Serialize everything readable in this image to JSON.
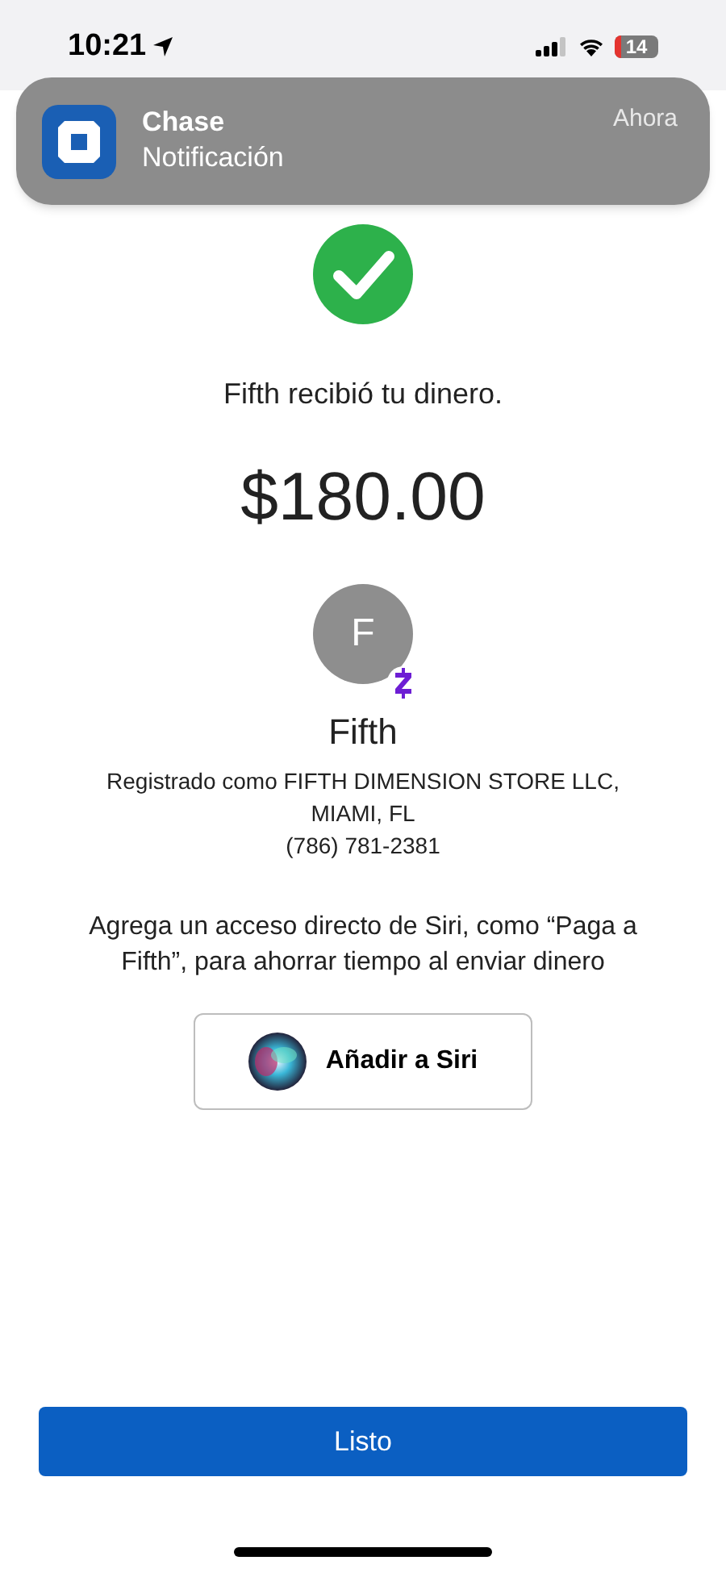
{
  "status_bar": {
    "time": "10:21",
    "battery": "14"
  },
  "notification": {
    "app": "Chase",
    "message": "Notificación",
    "time": "Ahora"
  },
  "confirmation": {
    "message": "Fifth recibió tu dinero.",
    "amount": "$180.00"
  },
  "recipient": {
    "initial": "F",
    "name": "Fifth",
    "registered": "Registrado como FIFTH DIMENSION STORE LLC,",
    "location": "MIAMI, FL",
    "phone": "(786) 781-2381"
  },
  "siri": {
    "prompt": "Agrega un acceso directo de Siri, como “Paga a Fifth”, para ahorrar tiempo al enviar dinero",
    "button": "Añadir a Siri"
  },
  "done_button": "Listo"
}
